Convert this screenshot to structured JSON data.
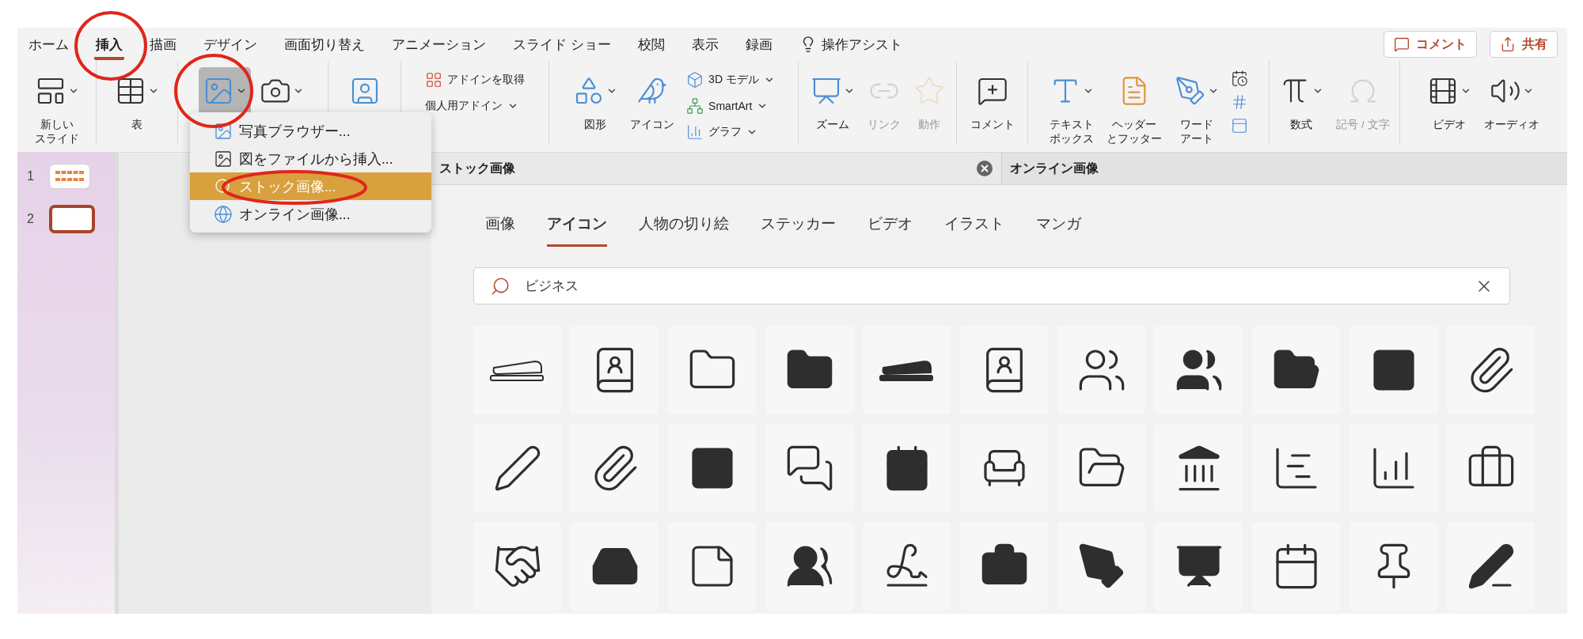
{
  "menu_tabs": [
    {
      "label": "ホーム",
      "selected": false
    },
    {
      "label": "挿入",
      "selected": true
    },
    {
      "label": "描画",
      "selected": false
    },
    {
      "label": "デザイン",
      "selected": false
    },
    {
      "label": "画面切り替え",
      "selected": false
    },
    {
      "label": "アニメーション",
      "selected": false
    },
    {
      "label": "スライド ショー",
      "selected": false
    },
    {
      "label": "校閲",
      "selected": false
    },
    {
      "label": "表示",
      "selected": false
    },
    {
      "label": "録画",
      "selected": false
    }
  ],
  "tell_me": {
    "label": "操作アシスト"
  },
  "header_buttons": [
    {
      "kind": "comment",
      "label": "コメント"
    },
    {
      "kind": "share",
      "label": "共有"
    }
  ],
  "ribbon": [
    {
      "items": [
        {
          "kind": "large",
          "lines": [
            "新しい",
            "スライド"
          ],
          "caret": true,
          "disabled": false,
          "pressed": false
        }
      ]
    },
    {
      "items": [
        {
          "kind": "large",
          "label": "表",
          "caret": true,
          "disabled": false,
          "pressed": false
        }
      ]
    },
    {
      "items": [
        {
          "kind": "large",
          "caret": true,
          "disabled": false,
          "pressed": true
        },
        {
          "kind": "large",
          "caret": true,
          "disabled": false,
          "pressed": false
        }
      ]
    },
    {
      "items": [
        {
          "kind": "large",
          "caret": false,
          "disabled": false,
          "pressed": false
        }
      ]
    },
    {
      "items": [
        {
          "kind": "small",
          "label": "アドインを取得",
          "caret": false,
          "disabled": false,
          "pressed": false
        },
        {
          "kind": "small",
          "label": "個人用アドイン",
          "caret": true,
          "disabled": false,
          "pressed": false
        }
      ]
    },
    {
      "items": [
        {
          "kind": "large",
          "label": "図形",
          "caret": true,
          "disabled": false,
          "pressed": false
        },
        {
          "kind": "large",
          "label": "アイコン",
          "caret": false,
          "disabled": false,
          "pressed": false
        },
        {
          "kind": "small",
          "label": "3D モデル",
          "caret": true,
          "disabled": false,
          "pressed": false
        },
        {
          "kind": "small",
          "label": "SmartArt",
          "caret": true,
          "disabled": false,
          "pressed": false
        },
        {
          "kind": "small",
          "label": "グラフ",
          "caret": true,
          "disabled": false,
          "pressed": false
        }
      ]
    },
    {
      "items": [
        {
          "kind": "large",
          "label": "ズーム",
          "caret": true,
          "disabled": false,
          "pressed": false
        },
        {
          "kind": "large",
          "label": "リンク",
          "caret": false,
          "disabled": true,
          "pressed": false
        },
        {
          "kind": "large",
          "label": "動作",
          "caret": false,
          "disabled": true,
          "pressed": false
        }
      ]
    },
    {
      "items": [
        {
          "kind": "large",
          "label": "コメント",
          "caret": false,
          "disabled": false,
          "pressed": false
        }
      ]
    },
    {
      "items": [
        {
          "kind": "large",
          "lines": [
            "テキスト",
            "ボックス"
          ],
          "caret": true,
          "disabled": false,
          "pressed": false
        },
        {
          "kind": "large",
          "lines": [
            "ヘッダー",
            "とフッター"
          ],
          "caret": false,
          "disabled": false,
          "pressed": false
        },
        {
          "kind": "large",
          "lines": [
            "ワード",
            "アート"
          ],
          "caret": true,
          "disabled": false,
          "pressed": false
        },
        {
          "kind": "mini",
          "caret": false,
          "disabled": false,
          "pressed": false
        },
        {
          "kind": "mini",
          "caret": false,
          "disabled": false,
          "pressed": false
        },
        {
          "kind": "mini",
          "caret": false,
          "disabled": false,
          "pressed": false
        }
      ]
    },
    {
      "items": [
        {
          "kind": "large",
          "label": "数式",
          "caret": true,
          "disabled": false,
          "pressed": false
        },
        {
          "kind": "large",
          "label": "記号 / 文字",
          "caret": false,
          "disabled": true,
          "pressed": false
        }
      ]
    },
    {
      "items": [
        {
          "kind": "large",
          "label": "ビデオ",
          "caret": true,
          "disabled": false,
          "pressed": false
        },
        {
          "kind": "large",
          "label": "オーディオ",
          "caret": true,
          "disabled": false,
          "pressed": false
        }
      ]
    }
  ],
  "insert_picture_menu": [
    {
      "label": "写真ブラウザー...",
      "selected": false
    },
    {
      "label": "図をファイルから挿入...",
      "selected": false
    },
    {
      "label": "ストック画像...",
      "selected": true
    },
    {
      "label": "オンライン画像...",
      "selected": false
    }
  ],
  "slides": [
    {
      "number": "1",
      "selected": false
    },
    {
      "number": "2",
      "selected": true
    }
  ],
  "pane_tabs": [
    {
      "label": "ストック画像",
      "selected": true,
      "closable": true
    },
    {
      "label": "オンライン画像",
      "selected": false,
      "closable": false
    }
  ],
  "categories": [
    {
      "label": "画像",
      "selected": false
    },
    {
      "label": "アイコン",
      "selected": true
    },
    {
      "label": "人物の切り絵",
      "selected": false
    },
    {
      "label": "ステッカー",
      "selected": false
    },
    {
      "label": "ビデオ",
      "selected": false
    },
    {
      "label": "イラスト",
      "selected": false
    },
    {
      "label": "マンガ",
      "selected": false
    }
  ],
  "search": {
    "value": "ビジネス"
  }
}
